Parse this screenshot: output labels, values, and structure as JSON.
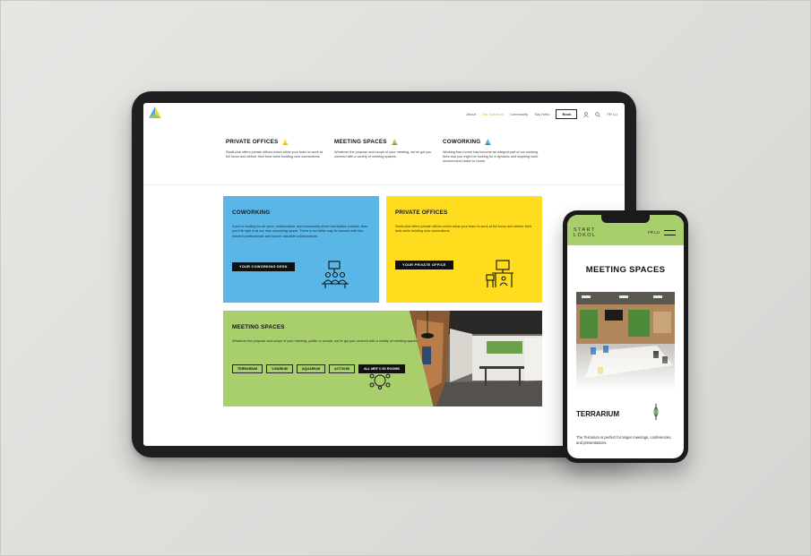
{
  "tablet": {
    "nav": {
      "items": [
        "About",
        "Our Solutions",
        "Community",
        "Say Hello"
      ],
      "active_index": 1,
      "book_label": "Book",
      "lang": "FR  LU"
    },
    "intro": [
      {
        "title": "PRIVATE OFFICES",
        "text": "StartLokal offers private offices which allow your team to work at full focus and deliver their best while building new connections.",
        "icon_color": "#ffd31e"
      },
      {
        "title": "MEETING SPACES",
        "text": "Whatever the purpose and scope of your meeting, we've got you covered with a variety of meeting spaces.",
        "icon_color": "#9cc85a"
      },
      {
        "title": "COWORKING",
        "text": "Working from home has become an integral part of our working lives and you might be looking for a dynamic and inspiring work environment closer to home.",
        "icon_color": "#4aa8e0"
      }
    ],
    "coworking_card": {
      "title": "COWORKING",
      "text": "If you're looking for an open, collaborative, and community-driven workplace solution, then you'll fit right in at our new coworking space. There is no better way to connect with like-minded professionals and launch valuable collaborations.",
      "button": "YOUR COWORKING DESK",
      "icon": "coworking-people-icon"
    },
    "private_card": {
      "title": "PRIVATE OFFICES",
      "text": "StartLokal offers private offices which allow your team to work at full focus and deliver their best while building new connections.",
      "button": "YOUR PRIVATE OFFICE",
      "icon": "desk-office-icon"
    },
    "meeting_card": {
      "title": "MEETING SPACES",
      "text": "Whatever the purpose and scope of your meeting, public or private, we've got you covered with a variety of meeting spaces.",
      "tags": [
        "TERRARIUM",
        "VIVARIUM",
        "AQUARIUM",
        "ACTIVUM"
      ],
      "all_button": "ALL MEETING ROOMS",
      "icon": "conference-table-icon"
    },
    "colors": {
      "coworking": "#5bb6e8",
      "private": "#ffdd1e",
      "meeting": "#a8cf6c"
    }
  },
  "phone": {
    "logo_line1": "START",
    "logo_line2": "LOKOL",
    "lang": "FR  LU",
    "title": "MEETING SPACES",
    "subtitle": "TERRARIUM",
    "text": "The Terrarium is perfect for larger meetings, conferences, and presentations.",
    "icons": [
      "menu-icon",
      "leaf-icon"
    ]
  }
}
